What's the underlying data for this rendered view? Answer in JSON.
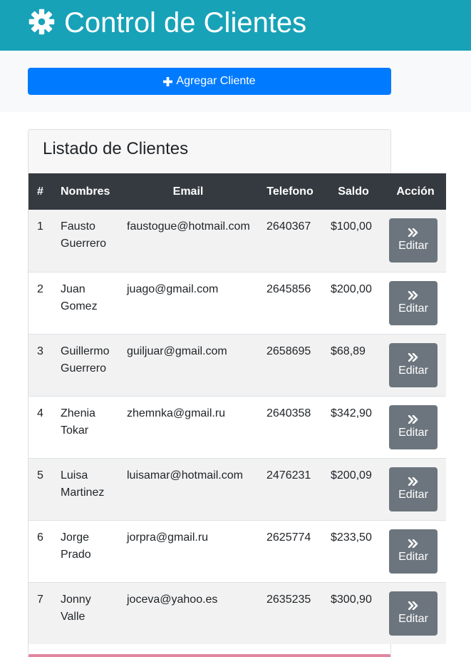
{
  "header": {
    "title": "Control de Clientes",
    "icon": "gear-icon"
  },
  "actions": {
    "add_label": "Agregar Cliente",
    "add_icon": "plus-icon"
  },
  "card": {
    "title": "Listado de Clientes"
  },
  "table": {
    "columns": [
      "#",
      "Nombres",
      "Email",
      "Telefono",
      "Saldo",
      "Acción"
    ],
    "edit_label": "Editar",
    "edit_icon": "double-chevron-right-icon",
    "rows": [
      {
        "num": "1",
        "name": "Fausto Guerrero",
        "email": "faustogue@hotmail.com",
        "phone": "2640367",
        "balance": "$100,00"
      },
      {
        "num": "2",
        "name": "Juan Gomez",
        "email": "juago@gmail.com",
        "phone": "2645856",
        "balance": "$200,00"
      },
      {
        "num": "3",
        "name": "Guillermo Guerrero",
        "email": "guiljuar@gmail.com",
        "phone": "2658695",
        "balance": "$68,89"
      },
      {
        "num": "4",
        "name": "Zhenia Tokar",
        "email": "zhemnka@gmail.ru",
        "phone": "2640358",
        "balance": "$342,90"
      },
      {
        "num": "5",
        "name": "Luisa Martinez",
        "email": "luisamar@hotmail.com",
        "phone": "2476231",
        "balance": "$200,09"
      },
      {
        "num": "6",
        "name": "Jorge Prado",
        "email": "jorpra@gmail.ru",
        "phone": "2625774",
        "balance": "$233,50"
      },
      {
        "num": "7",
        "name": "Jonny Valle",
        "email": "joceva@yahoo.es",
        "phone": "2635235",
        "balance": "$300,90"
      }
    ]
  },
  "colors": {
    "header_bg": "#17a2b8",
    "primary": "#007bff",
    "table_head": "#343a40",
    "edit_button": "#6c757d"
  }
}
